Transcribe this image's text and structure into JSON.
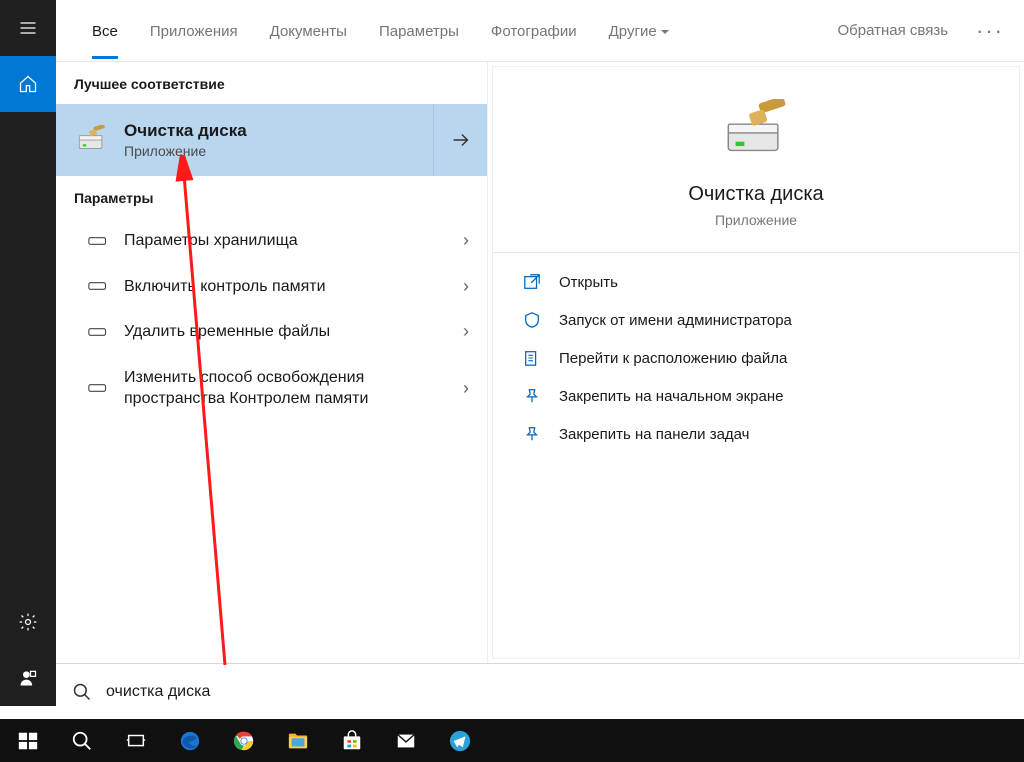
{
  "top": {
    "tabs": [
      "Все",
      "Приложения",
      "Документы",
      "Параметры",
      "Фотографии",
      "Другие"
    ],
    "feedback": "Обратная связь"
  },
  "left": {
    "best_header": "Лучшее соответствие",
    "best": {
      "title": "Очистка диска",
      "subtitle": "Приложение"
    },
    "params_header": "Параметры",
    "params": [
      "Параметры хранилища",
      "Включить контроль памяти",
      "Удалить временные файлы",
      "Изменить способ освобождения пространства Контролем памяти"
    ]
  },
  "right": {
    "title": "Очистка диска",
    "subtitle": "Приложение",
    "actions": [
      "Открыть",
      "Запуск от имени администратора",
      "Перейти к расположению файла",
      "Закрепить на начальном экране",
      "Закрепить на панели задач"
    ]
  },
  "search": {
    "value": "очистка диска"
  }
}
